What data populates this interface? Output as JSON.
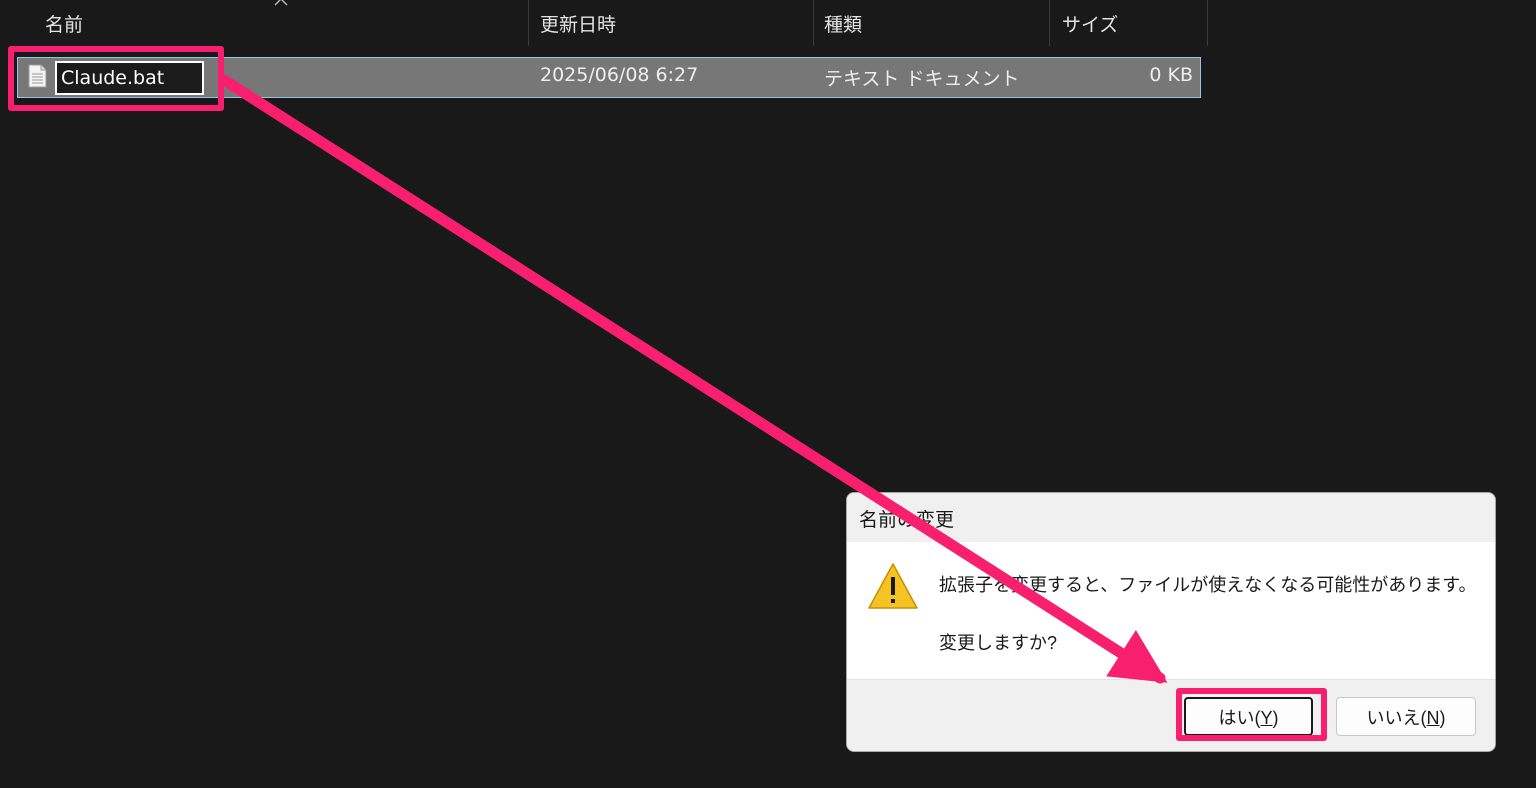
{
  "explorer": {
    "columns": {
      "name": "名前",
      "modified": "更新日時",
      "type": "種類",
      "size": "サイズ"
    },
    "file": {
      "icon": "text-document-icon",
      "name": "Claude.bat",
      "modified": "2025/06/08 6:27",
      "type": "テキスト ドキュメント",
      "size": "0 KB"
    }
  },
  "dialog": {
    "title": "名前の変更",
    "icon": "warning-icon",
    "message": "拡張子を変更すると、ファイルが使えなくなる可能性があります。",
    "question": "変更しますか?",
    "yes_button": {
      "label": "はい(",
      "accel": "Y",
      "close": ")"
    },
    "no_button": {
      "label": "いいえ(",
      "accel": "N",
      "close": ")"
    }
  },
  "annotation": {
    "color": "#f8206e"
  },
  "colors": {
    "background": "#191919",
    "selected_row": "#777777",
    "selected_border": "#98c5e6",
    "warning_yellow": "#f6c324"
  }
}
